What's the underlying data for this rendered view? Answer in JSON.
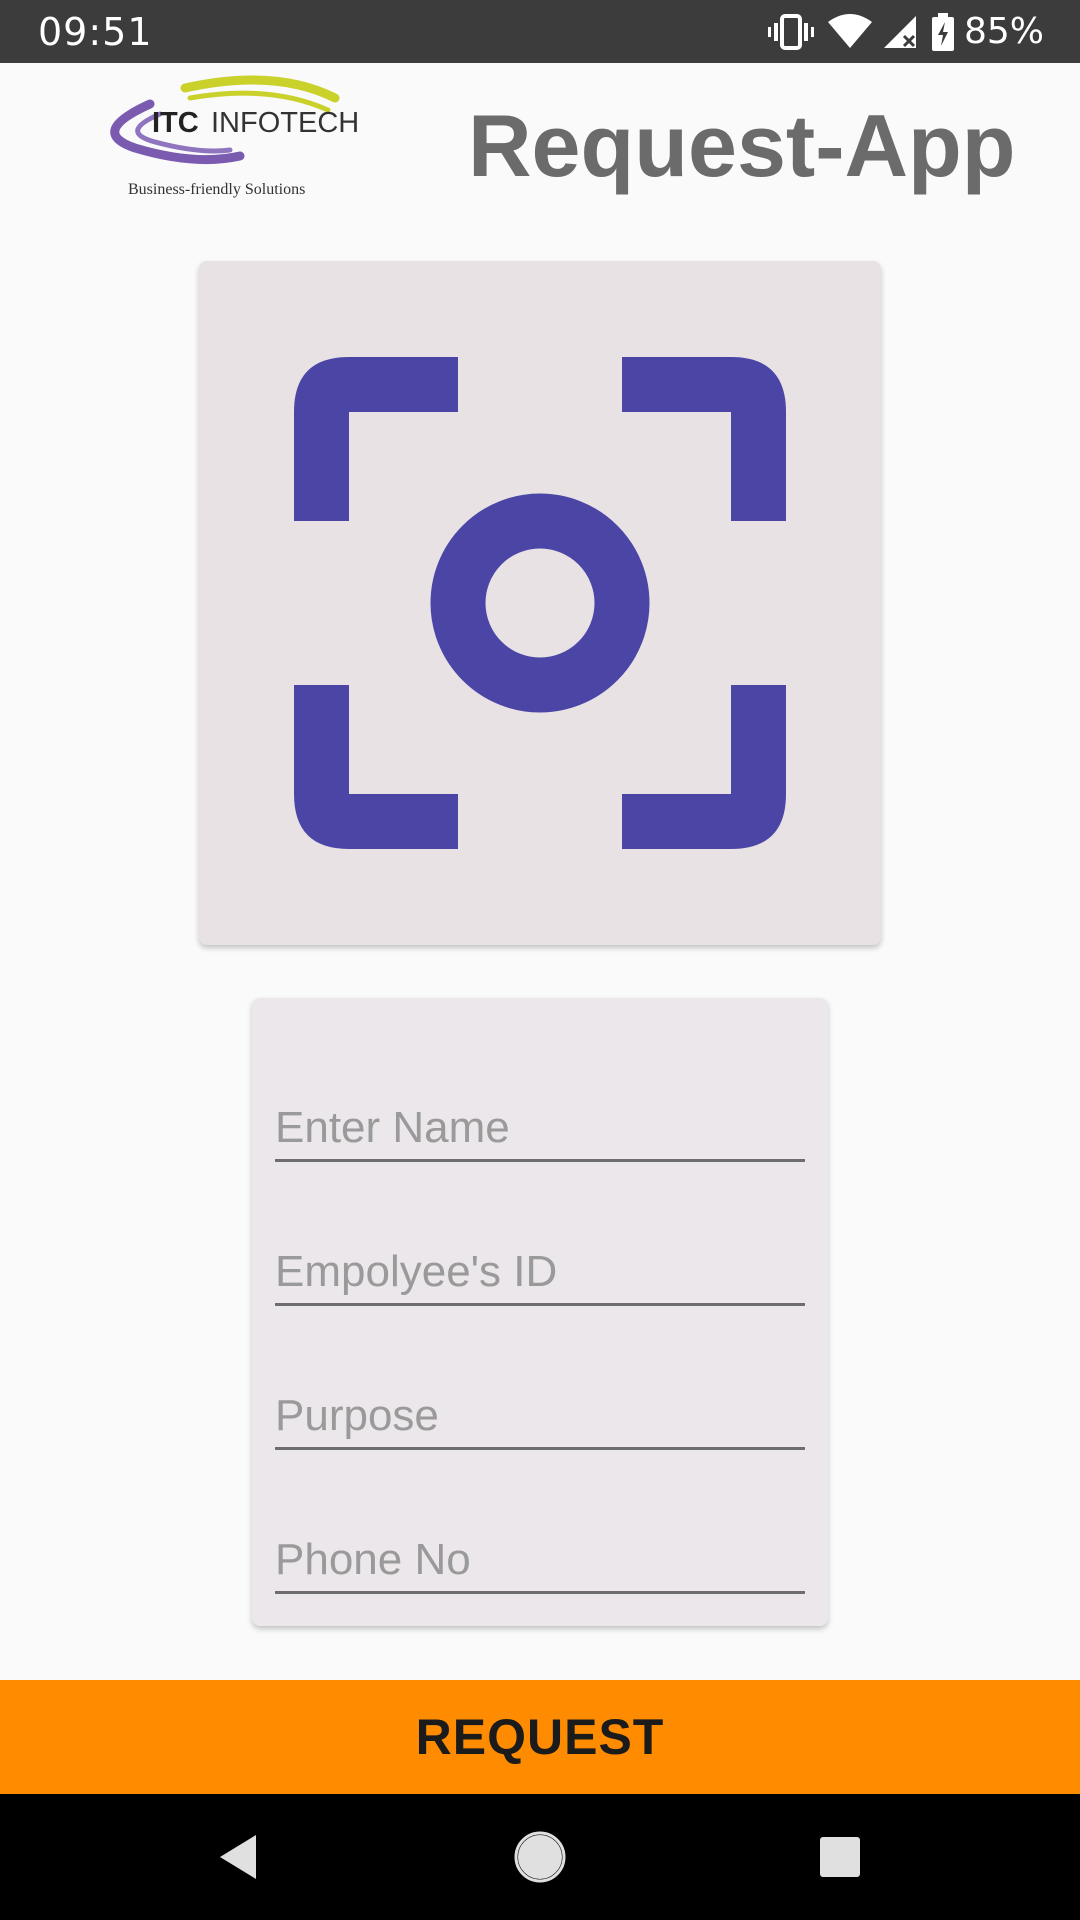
{
  "status_bar": {
    "time": "09:51",
    "battery": "85%",
    "icons": [
      "vibrate-icon",
      "wifi-icon",
      "signal-icon",
      "battery-charging-icon"
    ]
  },
  "header": {
    "logo": {
      "name": "ITC INFOTECH",
      "tagline": "Business-friendly Solutions"
    },
    "title": "Request-App"
  },
  "scan": {
    "icon": "camera-scan-icon",
    "color": "#4b46a6"
  },
  "form": {
    "fields": [
      {
        "placeholder": "Enter Name",
        "value": ""
      },
      {
        "placeholder": "Empolyee's ID",
        "value": ""
      },
      {
        "placeholder": "Purpose",
        "value": ""
      },
      {
        "placeholder": "Phone No",
        "value": ""
      }
    ]
  },
  "actions": {
    "request_label": "REQUEST",
    "request_color": "#ff8c00"
  },
  "nav": {
    "icons": [
      "back-icon",
      "home-icon",
      "recents-icon"
    ]
  }
}
